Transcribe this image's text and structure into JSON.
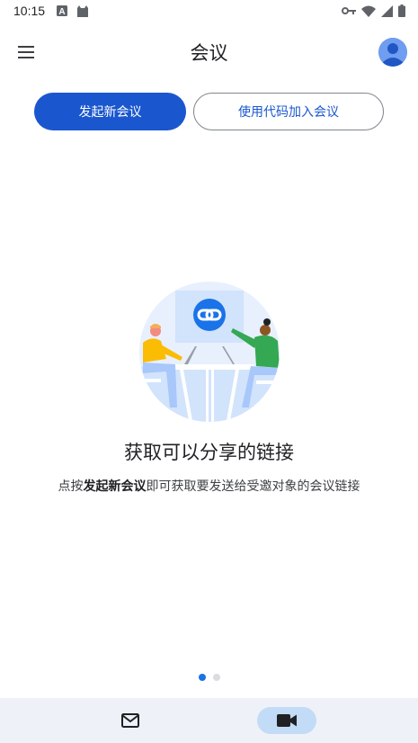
{
  "status_bar": {
    "time": "10:15",
    "left_icons": [
      "text-a-icon",
      "cat-icon"
    ],
    "right_icons": [
      "vpn-key-icon",
      "wifi-icon",
      "signal-icon",
      "battery-icon"
    ]
  },
  "app_bar": {
    "title": "会议",
    "menu_icon": "menu-icon",
    "avatar_icon": "account-avatar"
  },
  "actions": {
    "new_meeting": "发起新会议",
    "join_with_code": "使用代码加入会议"
  },
  "onboarding": {
    "headline": "获取可以分享的链接",
    "desc_prefix": "点按",
    "desc_bold": "发起新会议",
    "desc_suffix": "即可获取要发送给受邀对象的会议链接",
    "page_count": 2,
    "active_page": 1
  },
  "bottom_nav": {
    "items": [
      {
        "icon": "mail-icon",
        "selected": false
      },
      {
        "icon": "video-camera-icon",
        "selected": true
      }
    ]
  },
  "colors": {
    "primary": "#1a57cf",
    "nav_background": "#eef1f7",
    "nav_selected": "#c2dbf7"
  }
}
